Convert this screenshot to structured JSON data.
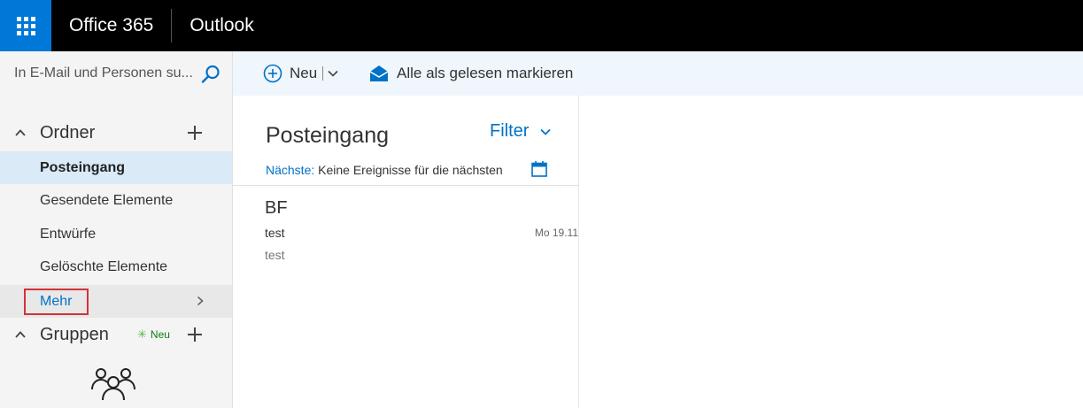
{
  "topbar": {
    "app_launcher_icon": "waffle-icon",
    "brand": "Office 365",
    "app_name": "Outlook",
    "accent_color": "#0078d7"
  },
  "search": {
    "placeholder": "In E-Mail und Personen su...",
    "icon": "search-icon"
  },
  "command_bar": {
    "new_label": "Neu",
    "mark_all_read_label": "Alle als gelesen markieren"
  },
  "folders_section": {
    "label": "Ordner",
    "items": [
      {
        "label": "Posteingang",
        "selected": true
      },
      {
        "label": "Gesendete Elemente",
        "selected": false
      },
      {
        "label": "Entwürfe",
        "selected": false
      },
      {
        "label": "Gelöschte Elemente",
        "selected": false
      }
    ],
    "more_label": "Mehr"
  },
  "groups_section": {
    "label": "Gruppen",
    "new_badge": "Neu"
  },
  "message_list": {
    "title": "Posteingang",
    "filter_label": "Filter",
    "next_label": "Nächste:",
    "next_text": "Keine Ereignisse für die nächsten",
    "messages": [
      {
        "sender": "BF",
        "subject": "test",
        "date": "Mo 19.11",
        "preview": "test"
      }
    ]
  }
}
